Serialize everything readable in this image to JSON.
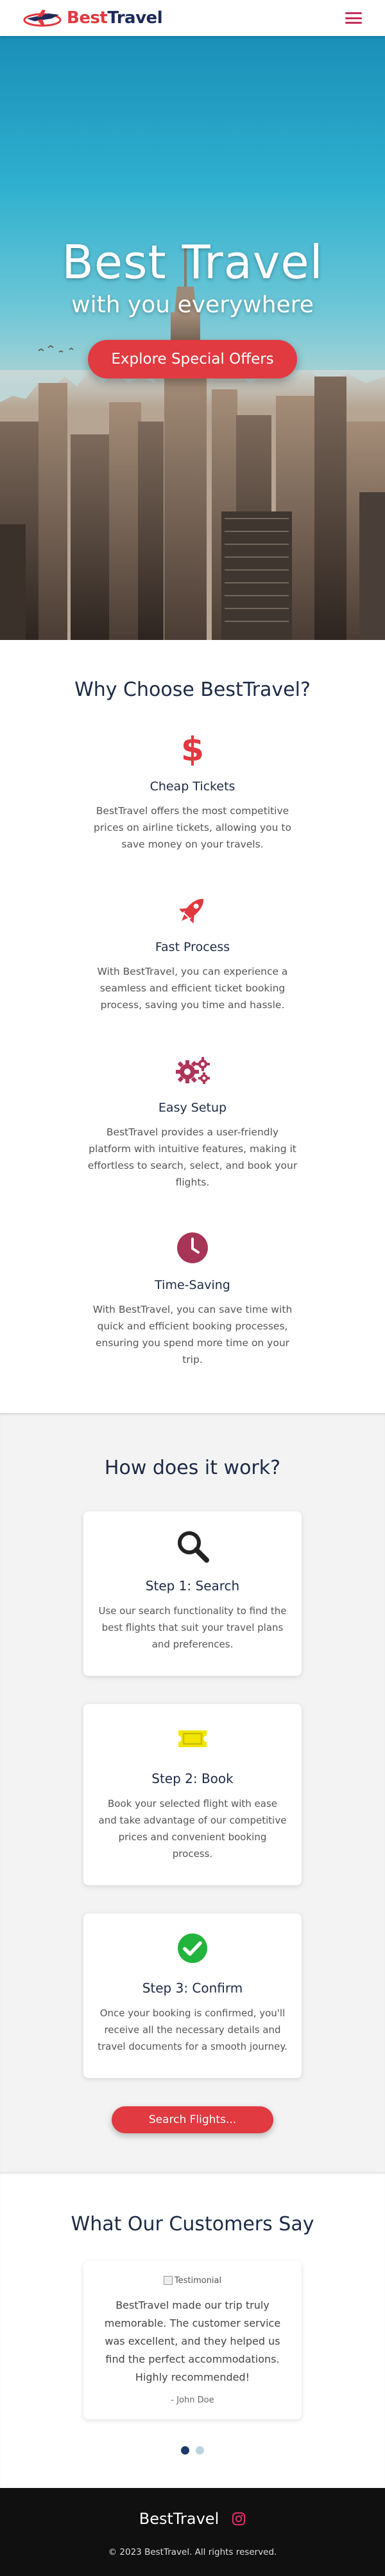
{
  "header": {
    "logo_best": "Best",
    "logo_travel": "Travel"
  },
  "hero": {
    "title": "Best Travel",
    "subtitle": "with you everywhere",
    "cta_label": "Explore Special Offers"
  },
  "features": {
    "title": "Why Choose BestTravel?",
    "items": [
      {
        "icon": "dollar-icon",
        "title": "Cheap Tickets",
        "desc": "BestTravel offers the most competitive prices on airline tickets, allowing you to save money on your travels."
      },
      {
        "icon": "rocket-icon",
        "title": "Fast Process",
        "desc": "With BestTravel, you can experience a seamless and efficient ticket booking process, saving you time and hassle."
      },
      {
        "icon": "gears-icon",
        "title": "Easy Setup",
        "desc": "BestTravel provides a user-friendly platform with intuitive features, making it effortless to search, select, and book your flights."
      },
      {
        "icon": "clock-icon",
        "title": "Time-Saving",
        "desc": "With BestTravel, you can save time with quick and efficient booking processes, ensuring you spend more time on your trip."
      }
    ]
  },
  "how": {
    "title": "How does it work?",
    "steps": [
      {
        "icon": "search-icon",
        "title": "Step 1: Search",
        "desc": "Use our search functionality to find the best flights that suit your travel plans and preferences."
      },
      {
        "icon": "ticket-icon",
        "title": "Step 2: Book",
        "desc": "Book your selected flight with ease and take advantage of our competitive prices and convenient booking process."
      },
      {
        "icon": "check-circle-icon",
        "title": "Step 3: Confirm",
        "desc": "Once your booking is confirmed, you'll receive all the necessary details and travel documents for a smooth journey."
      }
    ],
    "cta_label": "Search Flights..."
  },
  "testimonials": {
    "title": "What Our Customers Say",
    "image_alt": "Testimonial",
    "text": "BestTravel made our trip truly memorable. The customer service was excellent, and they helped us find the perfect accommodations. Highly recommended!",
    "author": "- John Doe"
  },
  "footer": {
    "brand": "BestTravel",
    "copyright": "© 2023 BestTravel. All rights reserved."
  },
  "colors": {
    "accent": "#e13a41",
    "navy": "#1c2a46",
    "icon_red": "#e2383f",
    "icon_maroon": "#b03459",
    "ticket_yellow": "#f2e600",
    "check_green": "#22b43c"
  }
}
